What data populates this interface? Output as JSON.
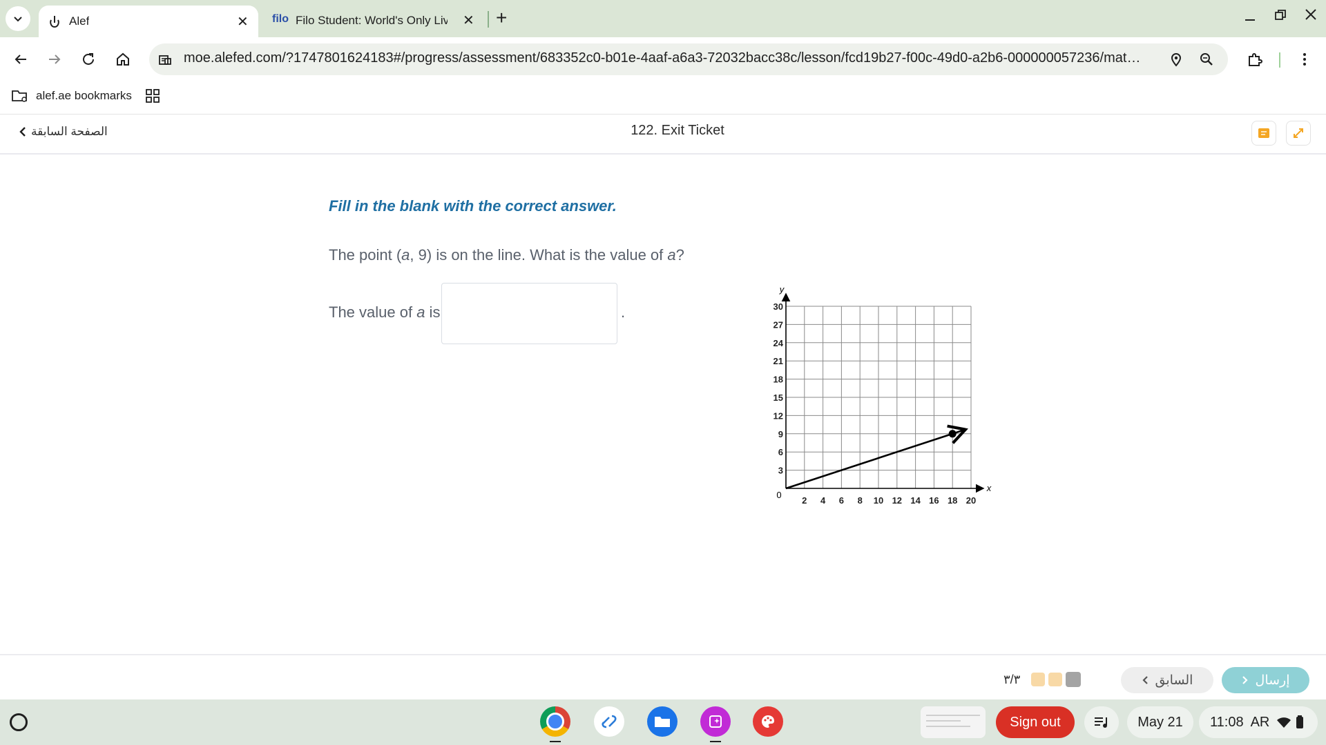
{
  "browser": {
    "tabs": [
      {
        "label": "Alef",
        "active": true
      },
      {
        "label": "Filo Student: World's Only Live I",
        "favicon_text": "filo",
        "active": false
      }
    ],
    "url": "moe.alefed.com/?1747801624183#/progress/assessment/683352c0-b01e-4aaf-a6a3-72032bacc38c/lesson/fcd19b27-f00c-49d0-a2b6-000000057236/material/...",
    "bookmarks": [
      {
        "label": "alef.ae bookmarks"
      }
    ]
  },
  "app": {
    "back_link": "الصفحة السابقة",
    "title": "122. Exit Ticket"
  },
  "question": {
    "instruction": "Fill in the blank with the correct answer.",
    "prompt_before": "The point (",
    "var_a": "a",
    "prompt_middle": ", 9) is on the line. What is the value of ",
    "prompt_end": "?",
    "answer_label_before": "The value of ",
    "answer_label_after": " is",
    "answer_value": "",
    "period": "."
  },
  "chart_data": {
    "type": "line",
    "xlabel": "x",
    "ylabel": "y",
    "xlim": [
      0,
      20
    ],
    "ylim": [
      0,
      30
    ],
    "x_ticks": [
      2,
      4,
      6,
      8,
      10,
      12,
      14,
      16,
      18,
      20
    ],
    "y_ticks": [
      3,
      6,
      9,
      12,
      15,
      18,
      21,
      24,
      27,
      30
    ],
    "origin_label": "0",
    "grid": true,
    "series": [
      {
        "points": [
          [
            0,
            0
          ],
          [
            18,
            9
          ]
        ],
        "arrow_end": true
      }
    ],
    "marked_points": [
      [
        18,
        9
      ]
    ]
  },
  "footer": {
    "progress_text": "٣/٣",
    "progress_colors": [
      "#f8d9a6",
      "#f8d9a6",
      "#a4a4a4"
    ],
    "prev_label": "السابق",
    "submit_label": "إرسال",
    "submit_color": "#8fd1d6"
  },
  "shelf": {
    "sign_out": "Sign out",
    "date": "May 21",
    "time": "11:08",
    "ime": "AR"
  }
}
